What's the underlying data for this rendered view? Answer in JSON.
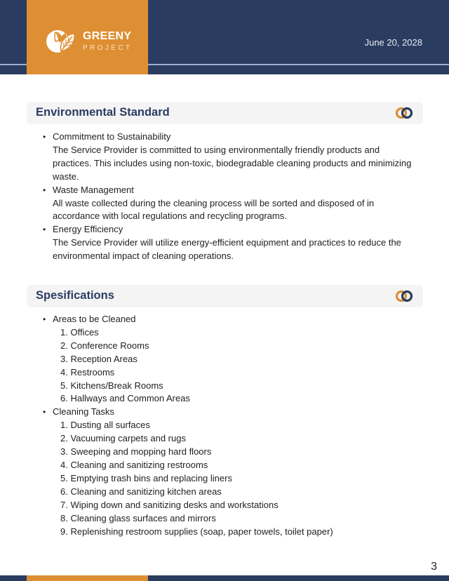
{
  "header": {
    "brand_name": "GREENY",
    "brand_sub": "PROJECT",
    "logo_icon": "leaf-logo-icon",
    "date": "June 20, 2028"
  },
  "colors": {
    "navy": "#2a3c60",
    "orange": "#de8f33",
    "section_bg": "#f4f4f5"
  },
  "sections": [
    {
      "title": "Environmental Standard",
      "icon": "interlocking-rings-icon",
      "items": [
        {
          "heading": "Commitment to Sustainability",
          "text": "The Service Provider is committed to using environmentally friendly products and practices. This includes using non-toxic, biodegradable cleaning products and minimizing waste."
        },
        {
          "heading": "Waste Management",
          "text": "All waste collected during the cleaning process will be sorted and disposed of in accordance with local regulations and recycling programs."
        },
        {
          "heading": "Energy Efficiency",
          "text": "The Service Provider will utilize energy-efficient equipment and practices to reduce the environmental impact of cleaning operations."
        }
      ]
    },
    {
      "title": "Spesifications",
      "icon": "interlocking-rings-icon",
      "groups": [
        {
          "heading": "Areas to be Cleaned",
          "items": [
            "1. Offices",
            "2. Conference Rooms",
            "3. Reception Areas",
            "4. Restrooms",
            "5. Kitchens/Break Rooms",
            "6. Hallways and Common Areas"
          ]
        },
        {
          "heading": "Cleaning Tasks",
          "items": [
            "1. Dusting all surfaces",
            "2. Vacuuming carpets and rugs",
            "3. Sweeping and mopping hard floors",
            "4. Cleaning and sanitizing restrooms",
            "5. Emptying trash bins and replacing liners",
            "6. Cleaning and sanitizing kitchen areas",
            "7. Wiping down and sanitizing desks and workstations",
            "8. Cleaning glass surfaces and mirrors",
            "9. Replenishing restroom supplies (soap, paper towels, toilet paper)"
          ]
        }
      ]
    }
  ],
  "footer": {
    "page_number": "3"
  }
}
